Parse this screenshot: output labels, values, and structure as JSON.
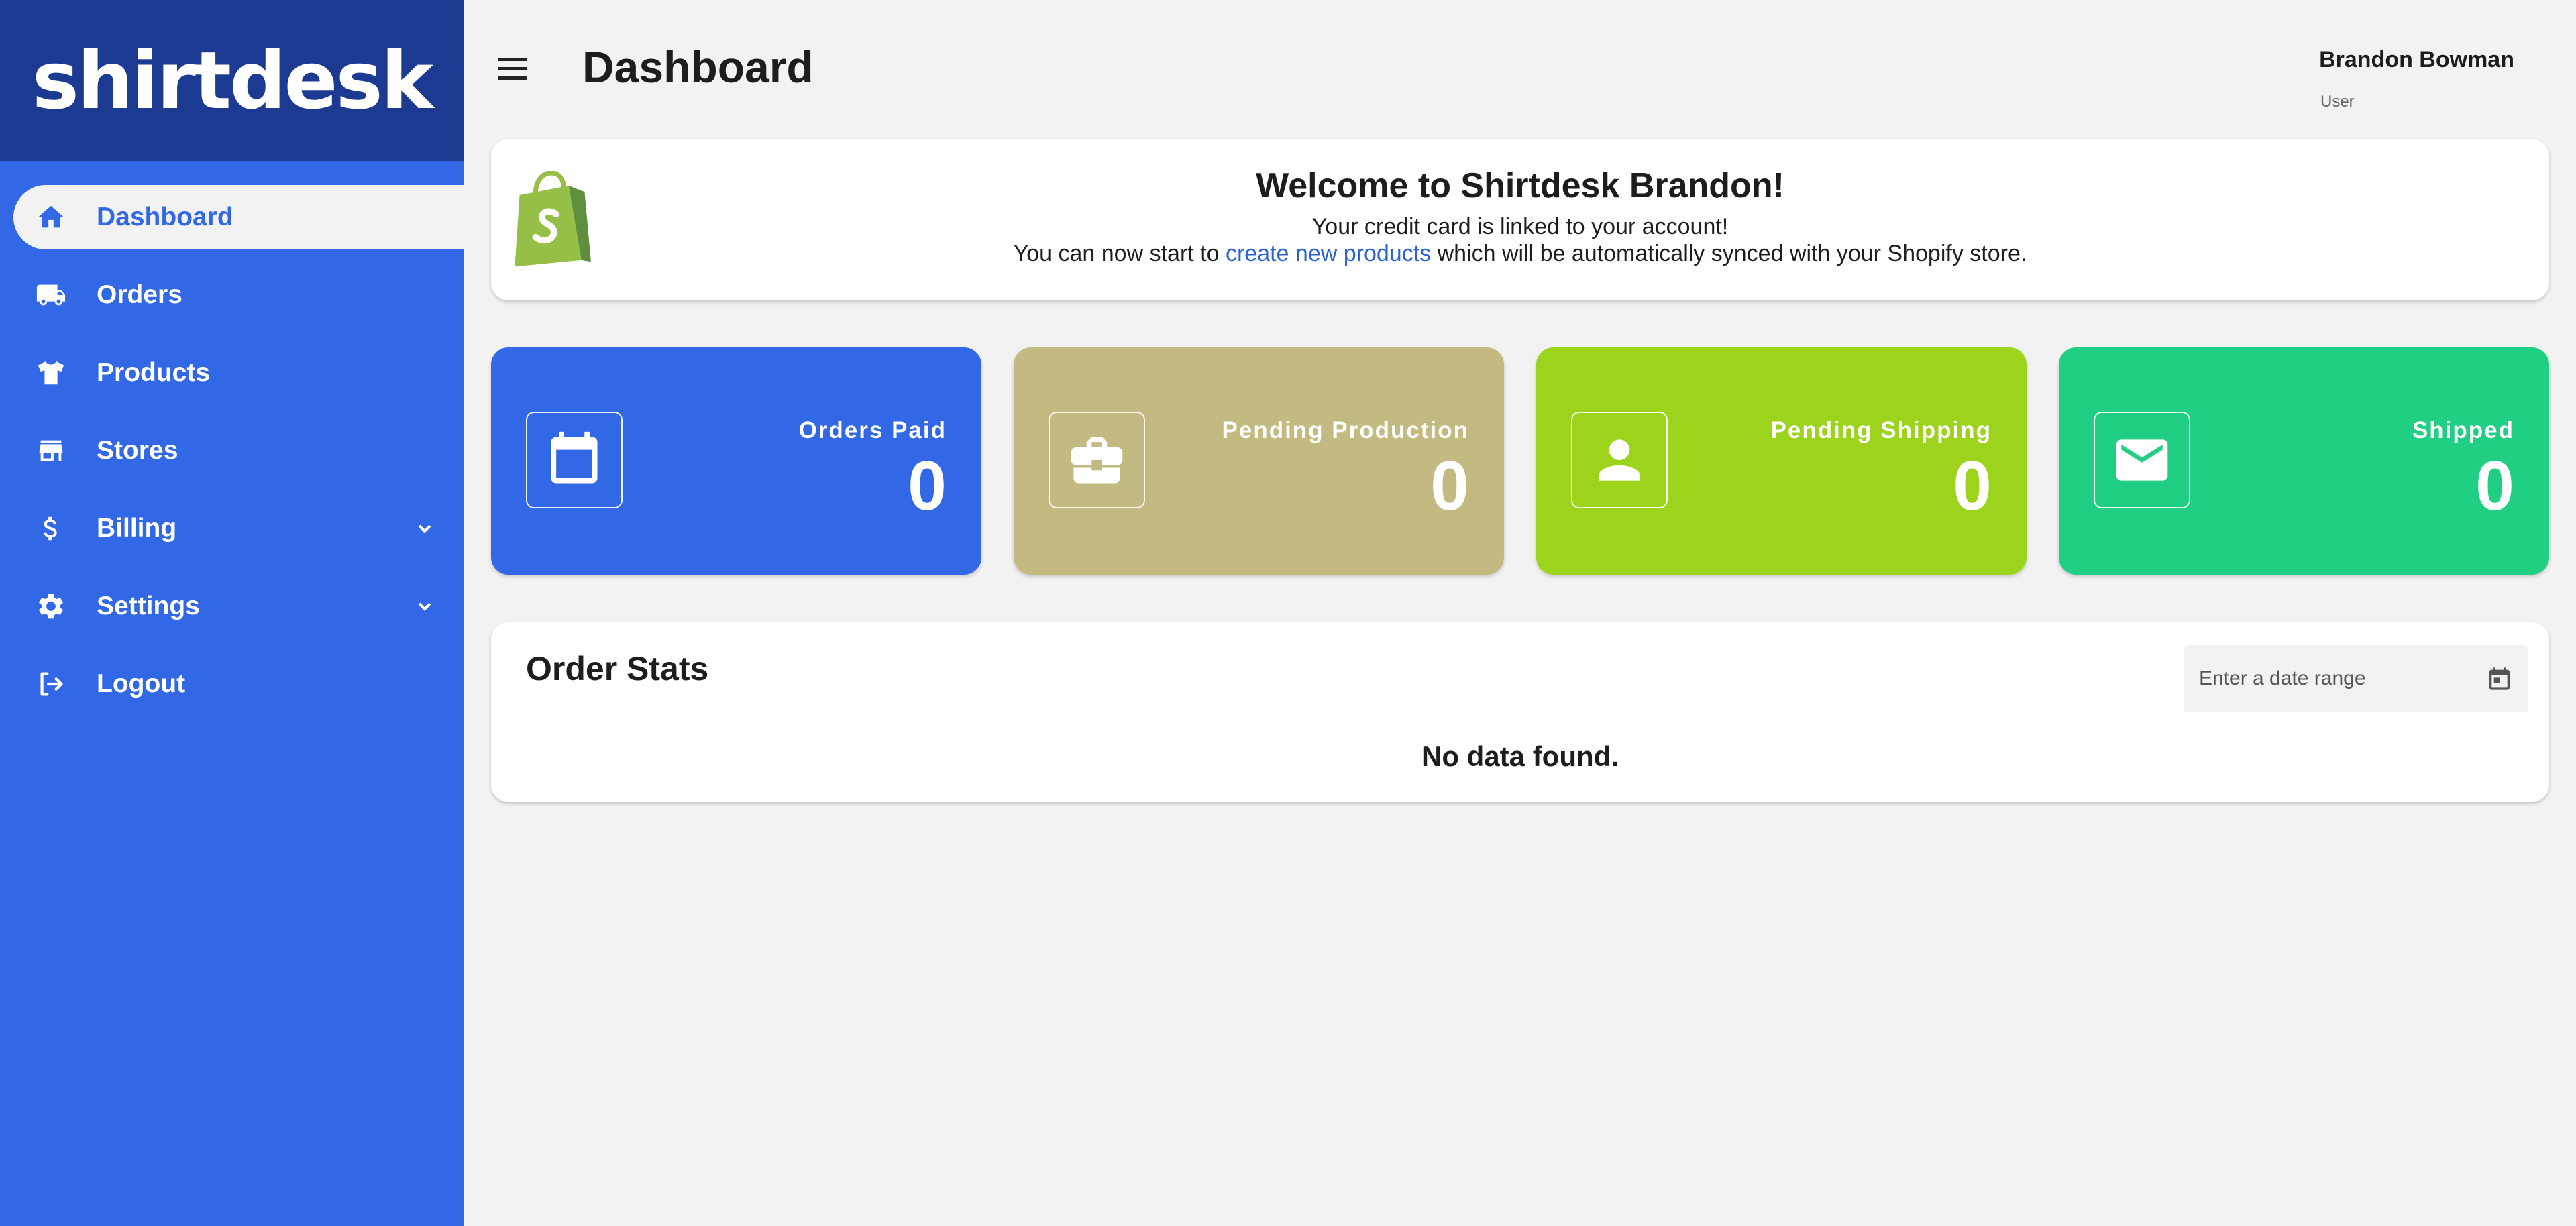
{
  "sidebar": {
    "logo": "shirtdesk",
    "items": [
      {
        "label": "Dashboard",
        "icon": "home-icon"
      },
      {
        "label": "Orders",
        "icon": "truck-icon"
      },
      {
        "label": "Products",
        "icon": "tshirt-icon"
      },
      {
        "label": "Stores",
        "icon": "store-icon"
      },
      {
        "label": "Billing",
        "icon": "dollar-icon"
      },
      {
        "label": "Settings",
        "icon": "gear-icon"
      },
      {
        "label": "Logout",
        "icon": "logout-icon"
      }
    ]
  },
  "header": {
    "title": "Dashboard",
    "user_name": "Brandon Bowman",
    "user_role": "User"
  },
  "welcome": {
    "title": "Welcome to Shirtdesk Brandon!",
    "line1": "Your credit card is linked to your account!",
    "line2_before": "You can now start to ",
    "link": "create new products",
    "line2_after": " which will be automatically synced with your Shopify store."
  },
  "stats": [
    {
      "label": "Orders Paid",
      "value": "0",
      "color": "#3268e6",
      "icon": "calendar-icon"
    },
    {
      "label": "Pending Production",
      "value": "0",
      "color": "#c2ba80",
      "icon": "briefcase-icon"
    },
    {
      "label": "Pending Shipping",
      "value": "0",
      "color": "#9cd31c",
      "icon": "person-icon"
    },
    {
      "label": "Shipped",
      "value": "0",
      "color": "#20cf84",
      "icon": "envelope-icon"
    }
  ],
  "order_stats": {
    "title": "Order Stats",
    "date_placeholder": "Enter a date range",
    "empty_message": "No data found."
  },
  "colors": {
    "sidebar": "#3268e6",
    "logo_bg": "#1c3a91",
    "background": "#f2f2f2",
    "link": "#2a62d6"
  }
}
